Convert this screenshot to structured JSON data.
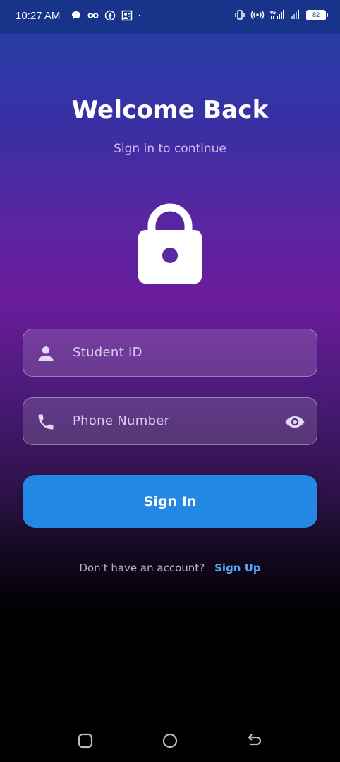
{
  "status_bar": {
    "time": "10:27 AM",
    "battery": "82",
    "network": "4G",
    "left_icons": [
      "chat-bubble-icon",
      "infinity-icon",
      "facebook-icon",
      "contact-card-icon",
      "dot-icon"
    ],
    "right_icons": [
      "vibrate-icon",
      "hotspot-icon",
      "signal-4g-icon",
      "signal-icon",
      "battery-icon"
    ]
  },
  "header": {
    "title": "Welcome Back",
    "subtitle": "Sign in to continue"
  },
  "hero_icon": "lock-icon",
  "form": {
    "student_id": {
      "placeholder": "Student ID",
      "value": "",
      "icon": "person-icon"
    },
    "phone": {
      "placeholder": "Phone Number",
      "value": "",
      "icon": "phone-icon",
      "trailing_icon": "eye-icon"
    },
    "submit_label": "Sign In"
  },
  "footer": {
    "prompt": "Don't have an account?",
    "link": "Sign Up"
  },
  "nav_bar": {
    "buttons": [
      "recents-button",
      "home-button",
      "back-button"
    ]
  },
  "colors": {
    "gradient_top": "#1f44a8",
    "gradient_mid": "#6a1c9b",
    "gradient_bottom": "#000000",
    "primary_button": "#2288e3",
    "link": "#54a6f0"
  }
}
